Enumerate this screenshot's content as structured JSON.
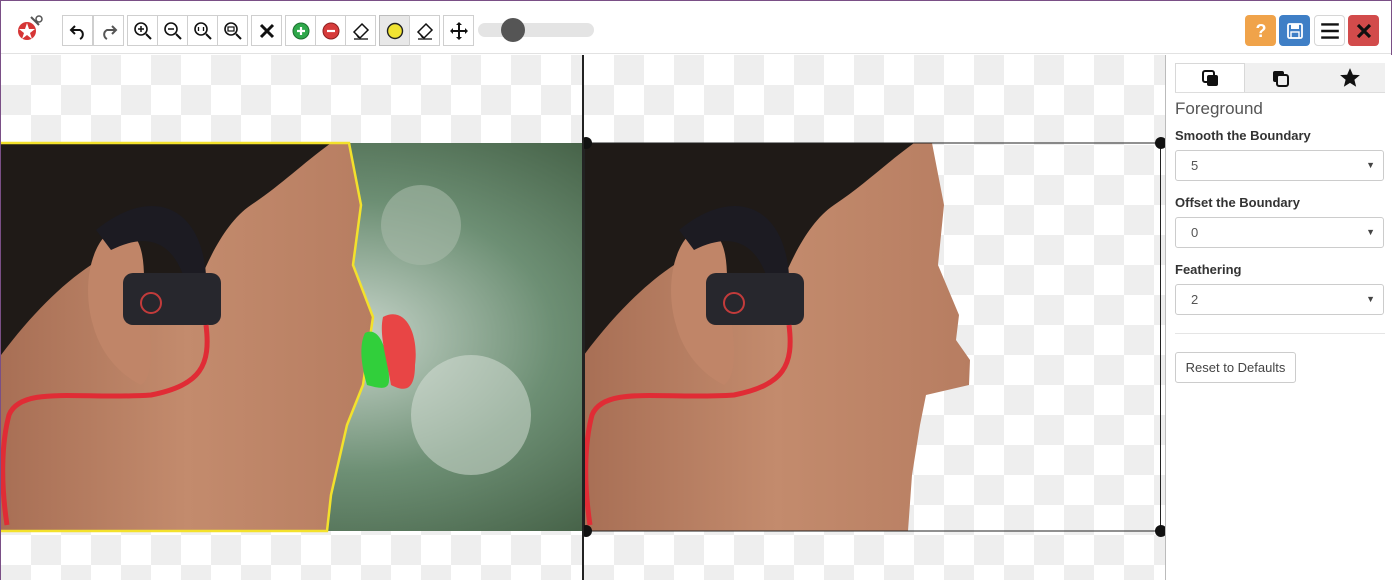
{
  "toolbar": {
    "tools": [
      {
        "name": "undo-icon"
      },
      {
        "name": "redo-icon"
      },
      {
        "name": "zoom-in-icon"
      },
      {
        "name": "zoom-out-icon"
      },
      {
        "name": "zoom-fit-icon"
      },
      {
        "name": "zoom-actual-icon"
      },
      {
        "name": "clear-marks-icon"
      },
      {
        "name": "mark-foreground-icon"
      },
      {
        "name": "mark-background-icon"
      },
      {
        "name": "eraser-icon"
      },
      {
        "name": "hair-brush-icon"
      },
      {
        "name": "eraser-icon"
      },
      {
        "name": "pan-icon"
      }
    ],
    "brush_size": 0.3,
    "colors": {
      "help": "#f0a34a",
      "save": "#3f7fc6",
      "close": "#d24b4b",
      "foreground": "#2ecc40",
      "background": "#e84545",
      "outline": "#f3e12c"
    }
  },
  "panel": {
    "tabs": [
      {
        "name": "foreground-tab-icon",
        "active": true
      },
      {
        "name": "background-tab-icon",
        "active": false
      },
      {
        "name": "star-tab-icon",
        "active": false
      }
    ],
    "title": "Foreground",
    "smooth_label": "Smooth the Boundary",
    "smooth_value": "5",
    "offset_label": "Offset the Boundary",
    "offset_value": "0",
    "feather_label": "Feathering",
    "feather_value": "2",
    "reset_label": "Reset to Defaults"
  }
}
